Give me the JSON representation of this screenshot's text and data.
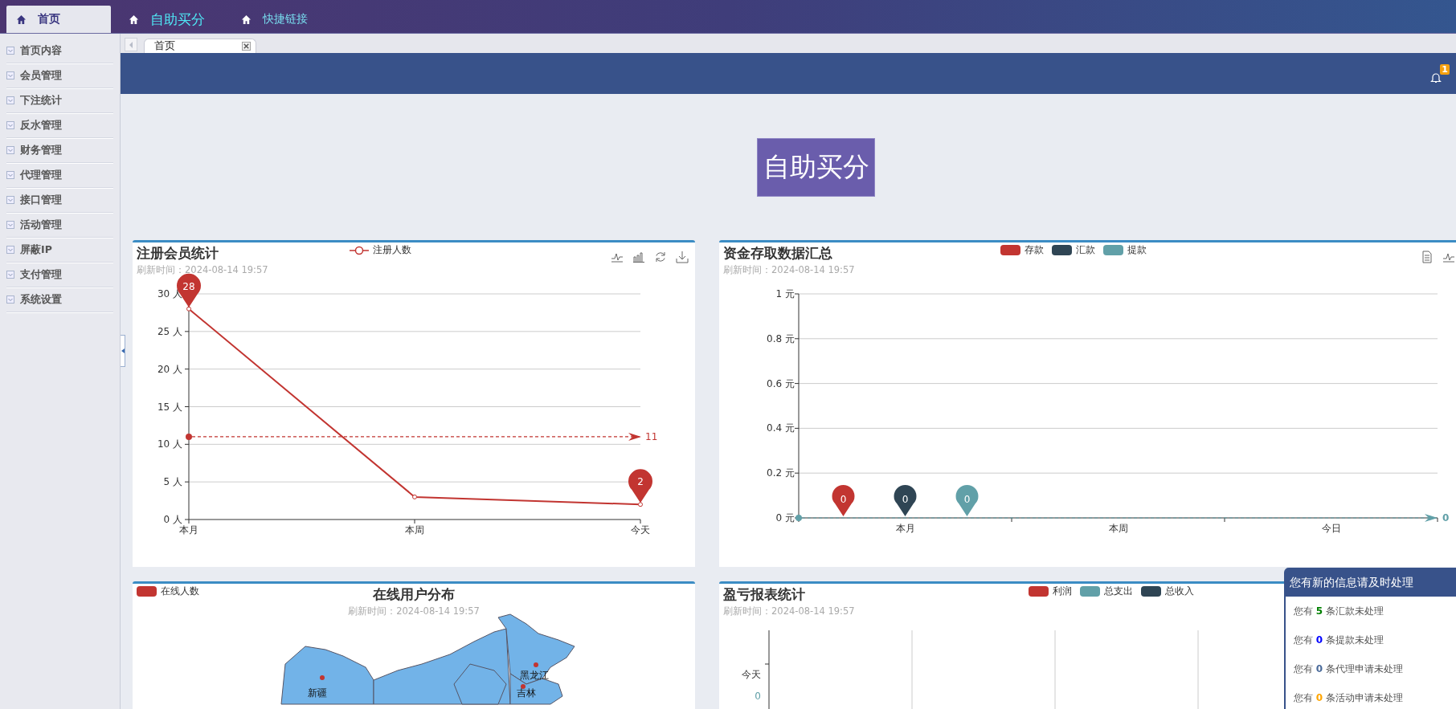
{
  "top_nav": [
    {
      "label": "首页",
      "selected": true,
      "highlighted": false
    },
    {
      "label": "自助买分",
      "selected": false,
      "highlighted": true
    },
    {
      "label": "快捷链接",
      "selected": false,
      "highlighted": false
    }
  ],
  "sidebar": {
    "items": [
      "首页内容",
      "会员管理",
      "下注统计",
      "反水管理",
      "财务管理",
      "代理管理",
      "接口管理",
      "活动管理",
      "屏蔽IP",
      "支付管理",
      "系统设置"
    ]
  },
  "tabs": [
    {
      "label": "首页",
      "selected": true
    }
  ],
  "header": {
    "notification_badge": "1"
  },
  "action_button": "自助买分",
  "registration_chart": {
    "title": "注册会员统计",
    "refresh": "刷新时间：2024-08-14 19:57",
    "chart_data": {
      "type": "line",
      "grid": true,
      "categories": [
        "本月",
        "本周",
        "今天"
      ],
      "series": [
        {
          "name": "注册人数",
          "color": "#c23531",
          "marker": "circle",
          "values": [
            28,
            3,
            2
          ]
        }
      ],
      "ylim": [
        0,
        30
      ],
      "yticks": [
        {
          "value": 0,
          "label": "0 人"
        },
        {
          "value": 5,
          "label": "5 人"
        },
        {
          "value": 10,
          "label": "10 人"
        },
        {
          "value": 15,
          "label": "15 人"
        },
        {
          "value": 20,
          "label": "20 人"
        },
        {
          "value": 25,
          "label": "25 人"
        },
        {
          "value": 30,
          "label": "30 人"
        }
      ],
      "annotations": [
        {
          "x": "本月",
          "y": 28,
          "text": "28"
        },
        {
          "x": "今天",
          "y": 2,
          "text": "2"
        }
      ],
      "ref_lines": [
        {
          "axis": "y",
          "value": 11,
          "label": "11",
          "color": "#c23531"
        }
      ]
    }
  },
  "funds_chart": {
    "title": "资金存取数据汇总",
    "refresh": "刷新时间：2024-08-14 19:57",
    "chart_data": {
      "type": "bar",
      "grid": true,
      "categories": [
        "本月",
        "本周",
        "今日"
      ],
      "series": [
        {
          "name": "存款",
          "color": "#c23531",
          "values": [
            0,
            0,
            0
          ]
        },
        {
          "name": "汇款",
          "color": "#2f4554",
          "values": [
            0,
            0,
            0
          ]
        },
        {
          "name": "提款",
          "color": "#61a0a8",
          "values": [
            0,
            0,
            0
          ]
        }
      ],
      "ylim": [
        0,
        1
      ],
      "yticks": [
        {
          "value": 0,
          "label": "0 元"
        },
        {
          "value": 0.2,
          "label": "0.2 元"
        },
        {
          "value": 0.4,
          "label": "0.4 元"
        },
        {
          "value": 0.6,
          "label": "0.6 元"
        },
        {
          "value": 0.8,
          "label": "0.8 元"
        },
        {
          "value": 1,
          "label": "1 元"
        }
      ],
      "annotations": [
        "0",
        "0",
        "0"
      ],
      "ref_lines": [
        {
          "axis": "y",
          "value": 0,
          "label": "0",
          "color": "#61a0a8"
        }
      ]
    }
  },
  "online_map": {
    "title": "在线用户分布",
    "refresh": "刷新时间：2024-08-14 19:57",
    "legend": "在线人数",
    "color": "#c23531",
    "regions": [
      {
        "name": "新疆"
      },
      {
        "name": "黑龙江"
      },
      {
        "name": "吉林"
      }
    ]
  },
  "profit_chart": {
    "title": "盈亏报表统计",
    "refresh": "刷新时间：2024-08-14 19:57",
    "legend": [
      {
        "name": "利润",
        "color": "#c23531"
      },
      {
        "name": "总支出",
        "color": "#61a0a8"
      },
      {
        "name": "总收入",
        "color": "#2f4554"
      }
    ],
    "row_label": "今天",
    "value_label": "0"
  },
  "notifications": {
    "title": "您有新的信息请及时处理",
    "items": [
      {
        "prefix": "您有",
        "count": "5",
        "suffix": "条汇款未处理",
        "color": "#008000"
      },
      {
        "prefix": "您有",
        "count": "0",
        "suffix": "条提款未处理",
        "color": "#0000ff"
      },
      {
        "prefix": "您有",
        "count": "0",
        "suffix": "条代理申请未处理",
        "color": "#4a6a9a"
      },
      {
        "prefix": "您有",
        "count": "0",
        "suffix": "条活动申请未处理",
        "color": "#ffa500"
      }
    ]
  }
}
